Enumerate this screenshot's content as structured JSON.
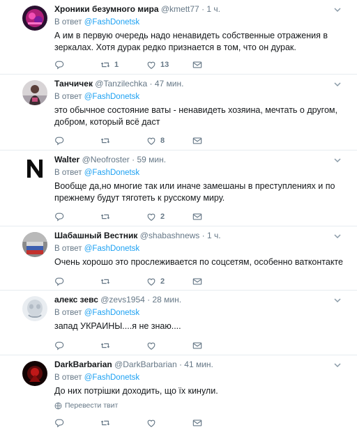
{
  "tweets": [
    {
      "name": "Хроники безумного мира",
      "handle": "@kmett77",
      "time": "· 1 ч.",
      "reply_prefix": "В ответ",
      "reply_to": "@FashDonetsk",
      "text": "А им в первую очередь надо ненавидеть собственные отражения в зеркалах. Хотя дурак редко признается в том, что он дурак.",
      "retweets": "1",
      "likes": "13",
      "avatar_icon": "avatar-pink-glitch"
    },
    {
      "name": "Танчичек",
      "handle": "@Tanzilechka",
      "time": "· 47 мин.",
      "reply_prefix": "В ответ",
      "reply_to": "@FashDonetsk",
      "text": "это обычное состояние ваты - ненавидеть хозяина, мечтать о другом, добром, который всё даст",
      "retweets": "",
      "likes": "8",
      "avatar_icon": "avatar-photo"
    },
    {
      "name": "Walter",
      "handle": "@Neofroster",
      "time": "· 59 мин.",
      "reply_prefix": "В ответ",
      "reply_to": "@FashDonetsk",
      "text": "Вообще да,но многие так или иначе замешаны в преступлениях и по прежнему будут тяготеть к русскому миру.",
      "retweets": "",
      "likes": "2",
      "avatar_letter": "N"
    },
    {
      "name": "Шабашный Вестник",
      "handle": "@shabashnews",
      "time": "· 1 ч.",
      "reply_prefix": "В ответ",
      "reply_to": "@FashDonetsk",
      "text": "Очень хорошо это прослеживается по соцсетям, особенно ватконтакте",
      "retweets": "",
      "likes": "2",
      "avatar_icon": "avatar-flag"
    },
    {
      "name": "алекс зевс",
      "handle": "@zevs1954",
      "time": "· 28 мин.",
      "reply_prefix": "В ответ",
      "reply_to": "@FashDonetsk",
      "text": "запад УКРАИНЫ....я не знаю....",
      "retweets": "",
      "likes": "",
      "avatar_icon": "avatar-default-gray"
    },
    {
      "name": "DarkBarbarian",
      "handle": "@DarkBarbarian",
      "time": "· 41 мин.",
      "reply_prefix": "В ответ",
      "reply_to": "@FashDonetsk",
      "text": "До них потрішки доходить, що їх кинули.",
      "translate": "Перевести твит",
      "retweets": "",
      "likes": "",
      "avatar_icon": "avatar-red-dark"
    }
  ],
  "colors": {
    "accent": "#1da1f2",
    "secondary_text": "#657786",
    "border": "#e6ecf0"
  }
}
